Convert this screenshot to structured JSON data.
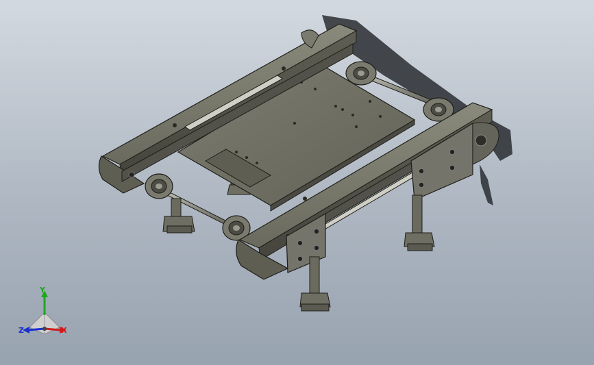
{
  "viewport": {
    "background_top": "#d3d9e0",
    "background_bottom": "#98a3b0",
    "part_color": "#6e6e62",
    "part_edge_color": "#1e1e1a",
    "shadow_color": "#2a2e33"
  },
  "model": {
    "description_icon": "belt-conveyor-assembly-icon"
  },
  "triad": {
    "x_label": "X",
    "y_label": "Y",
    "z_label": "Z",
    "x_color": "#d11c1c",
    "y_color": "#1fa61f",
    "z_color": "#1c2fd1"
  }
}
